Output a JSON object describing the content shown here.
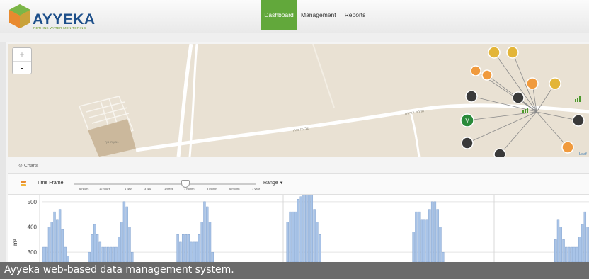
{
  "app": {
    "brand": "AYYEKA",
    "tagline": "RETHINK WATER MONITORING"
  },
  "nav": {
    "tabs": [
      {
        "label": "Dashboard",
        "active": true
      },
      {
        "label": "Management",
        "active": false
      },
      {
        "label": "Reports",
        "active": false
      }
    ]
  },
  "map": {
    "zoom_in": "+",
    "zoom_out": "-",
    "labels": [
      "גבעת נוף",
      "שבעת כנרת",
      "שדרת אורנים"
    ],
    "attribution": "Leaf",
    "colors": {
      "background": "#e9e1d3",
      "road": "#ffffff",
      "building": "#cbb89c"
    },
    "sensors": [
      {
        "icon": "sensor-icon",
        "label": "",
        "color": "#e3b538"
      },
      {
        "icon": "sensor-icon",
        "label": "",
        "color": "#e3b538"
      },
      {
        "icon": "sensor-icon",
        "label": "",
        "color": "#f09a3d"
      },
      {
        "icon": "sensor-icon",
        "label": "",
        "color": "#f09a3d"
      },
      {
        "icon": "sensor-icon",
        "label": "",
        "color": "#f09a3d"
      },
      {
        "icon": "sensor-icon",
        "label": "",
        "color": "#e3b538"
      },
      {
        "icon": "pulse-icon",
        "label": "",
        "color": "#3a3a3a"
      },
      {
        "icon": "pulse-icon",
        "label": "",
        "color": "#3a3a3a"
      },
      {
        "icon": "pulse-icon",
        "label": "",
        "color": "#3a3a3a"
      },
      {
        "icon": "valve-icon",
        "label": "V",
        "color": "#2a8a3a"
      },
      {
        "icon": "pulse-icon",
        "label": "",
        "color": "#3a3a3a"
      },
      {
        "icon": "pulse-icon",
        "label": "",
        "color": "#3a3a3a"
      },
      {
        "icon": "pulse-icon",
        "label": "",
        "color": "#3a3a3a"
      },
      {
        "icon": "sensor-icon",
        "label": "",
        "color": "#f09a3d"
      }
    ]
  },
  "charts": {
    "section_title": "Charts",
    "time_frame_label": "Time Frame",
    "range_label": "Range",
    "time_options": [
      "6 hours",
      "12 hours",
      "1 day",
      "3 day",
      "1 week",
      "1 month",
      "3 month",
      "6 month",
      "1 year"
    ],
    "selected_time": "1 month"
  },
  "chart_data": {
    "type": "bar",
    "ylabel": "m³",
    "yticks": [
      300,
      400,
      500
    ],
    "ylim": [
      250,
      550
    ],
    "grid": true,
    "bar_color": "#a9c4e8",
    "values": [
      320,
      320,
      400,
      420,
      460,
      430,
      470,
      390,
      320,
      285,
      250,
      250,
      250,
      250,
      250,
      250,
      250,
      300,
      370,
      410,
      370,
      340,
      320,
      320,
      320,
      320,
      320,
      320,
      360,
      420,
      500,
      480,
      400,
      300,
      250,
      250,
      250,
      250,
      250,
      250,
      250,
      250,
      250,
      250,
      250,
      250,
      250,
      250,
      250,
      250,
      370,
      340,
      370,
      370,
      370,
      340,
      340,
      340,
      370,
      420,
      500,
      480,
      420,
      300,
      250,
      250,
      250,
      250,
      250,
      250,
      250,
      250,
      250,
      250,
      250,
      250,
      250,
      250,
      250,
      250,
      250,
      250,
      250,
      250,
      250,
      250,
      250,
      250,
      250,
      250,
      250,
      420,
      460,
      460,
      460,
      510,
      520,
      550,
      550,
      550,
      530,
      470,
      420,
      370,
      250,
      250,
      250,
      250,
      250,
      250,
      250,
      250,
      250,
      250,
      250,
      250,
      250,
      250,
      250,
      250,
      250,
      250,
      250,
      250,
      250,
      250,
      250,
      250,
      250,
      250,
      250,
      250,
      250,
      250,
      250,
      250,
      250,
      250,
      380,
      460,
      460,
      430,
      430,
      430,
      470,
      500,
      500,
      470,
      400,
      300,
      250,
      250,
      250,
      250,
      250,
      250,
      250,
      250,
      250,
      250,
      250,
      250,
      250,
      250,
      250,
      250,
      250,
      250,
      250,
      250,
      250,
      250,
      250,
      250,
      250,
      250,
      250,
      250,
      250,
      250,
      250,
      250,
      250,
      250,
      250,
      250,
      250,
      250,
      250,
      250,
      250,
      350,
      430,
      400,
      350,
      320,
      320,
      320,
      320,
      320,
      360,
      410,
      460,
      400
    ]
  },
  "caption": "Ayyeka web-based data management system."
}
